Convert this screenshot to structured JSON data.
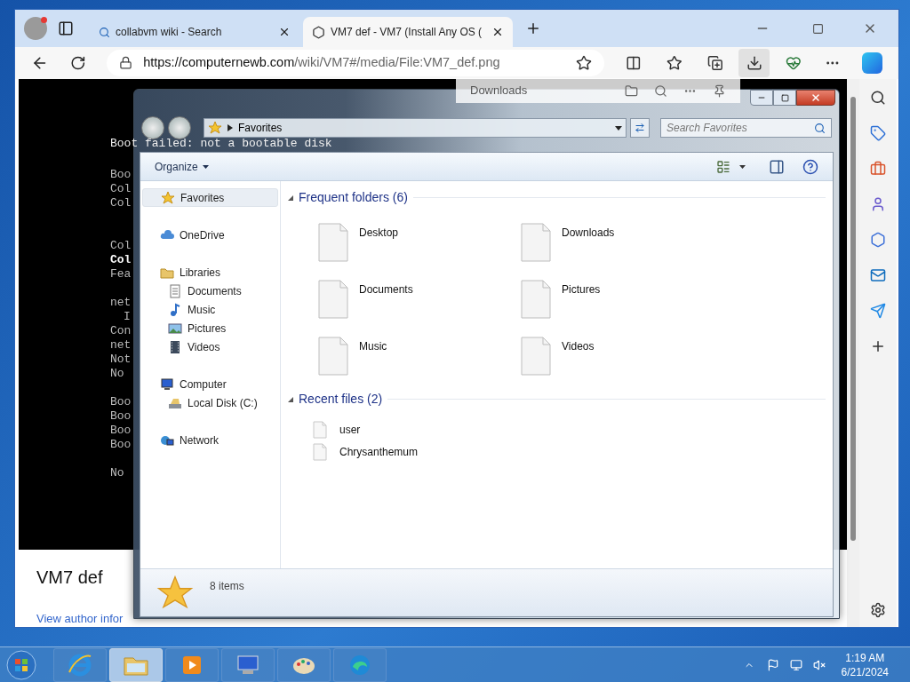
{
  "browser": {
    "tabs": [
      {
        "title": "collabvm wiki - Search",
        "kind": "search",
        "selected": false
      },
      {
        "title": "VM7 def - VM7 (Install Any OS (",
        "kind": "page",
        "selected": true
      }
    ],
    "url_host": "https://computernewb.com",
    "url_path": "/wiki/VM7#/media/File:VM7_def.png",
    "downloads_button": {
      "selected": true
    }
  },
  "page": {
    "console_blocks": [
      [
        {
          "text": "Boot failed: not a bootable disk",
          "kind": "normal"
        }
      ],
      [
        {
          "text": "Boo",
          "kind": "normal"
        },
        {
          "text": "Col",
          "kind": "normal"
        },
        {
          "text": "Col",
          "kind": "normal"
        }
      ],
      [
        {
          "text": "Col",
          "kind": "normal"
        },
        {
          "text": "Col",
          "kind": "bright"
        },
        {
          "text": "Fea",
          "kind": "normal"
        }
      ],
      [
        {
          "text": "net",
          "kind": "normal"
        },
        {
          "text": "I",
          "kind": "indented"
        },
        {
          "text": "Con",
          "kind": "normal"
        },
        {
          "text": "net",
          "kind": "normal"
        },
        {
          "text": "Not",
          "kind": "normal"
        },
        {
          "text": "No",
          "kind": "normal"
        }
      ],
      [
        {
          "text": "Boo",
          "kind": "normal"
        },
        {
          "text": "Boo",
          "kind": "normal"
        },
        {
          "text": "Boo",
          "kind": "normal"
        },
        {
          "text": "Boo",
          "kind": "normal"
        }
      ],
      [
        {
          "text": "No",
          "kind": "normal"
        }
      ]
    ],
    "title": "VM7 def",
    "author_link": "View author infor"
  },
  "downloads_flyout": {
    "title": "Downloads"
  },
  "explorer": {
    "address": "Favorites",
    "search_placeholder": "Search Favorites",
    "organize": "Organize",
    "nav": [
      {
        "label": "Favorites",
        "kind": "favorites",
        "selected": true
      },
      {
        "label": "OneDrive",
        "kind": "cloud",
        "selected": false
      },
      {
        "label": "Libraries",
        "kind": "library",
        "selected": false,
        "children": [
          {
            "label": "Documents",
            "kind": "documents",
            "selected": false
          },
          {
            "label": "Music",
            "kind": "music",
            "selected": false
          },
          {
            "label": "Pictures",
            "kind": "pictures",
            "selected": false
          },
          {
            "label": "Videos",
            "kind": "videos",
            "selected": false
          }
        ]
      },
      {
        "label": "Computer",
        "kind": "computer",
        "selected": false,
        "children": [
          {
            "label": "Local Disk (C:)",
            "kind": "disk",
            "selected": false
          }
        ]
      },
      {
        "label": "Network",
        "kind": "network",
        "selected": false
      }
    ],
    "groups": [
      {
        "title": "Frequent folders (6)",
        "kind": "tiles",
        "expanded": true,
        "items": [
          "Desktop",
          "Downloads",
          "Documents",
          "Pictures",
          "Music",
          "Videos"
        ]
      },
      {
        "title": "Recent files (2)",
        "kind": "list",
        "expanded": true,
        "items": [
          "user",
          "Chrysanthemum"
        ]
      }
    ],
    "status": "8 items"
  },
  "taskbar": {
    "apps": [
      {
        "kind": "ie",
        "selected": false
      },
      {
        "kind": "explorer",
        "selected": true
      },
      {
        "kind": "media",
        "selected": false
      },
      {
        "kind": "remote",
        "selected": false
      },
      {
        "kind": "paint",
        "selected": false
      },
      {
        "kind": "edge",
        "selected": false
      }
    ],
    "time": "1:19 AM",
    "date": "6/21/2024"
  }
}
